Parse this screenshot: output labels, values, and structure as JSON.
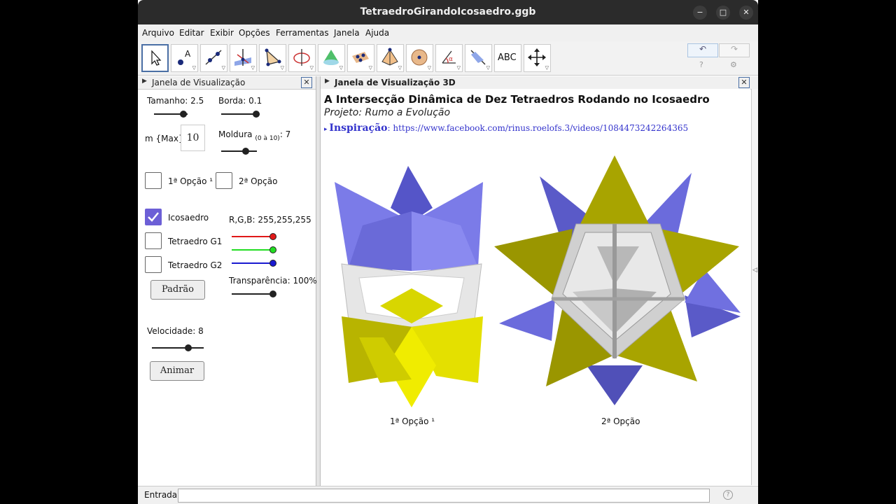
{
  "window": {
    "title": "TetraedroGirandoIcosaedro.ggb",
    "minimize": "−",
    "maximize": "□",
    "close": "✕"
  },
  "menu": [
    "Arquivo",
    "Editar",
    "Exibir",
    "Opções",
    "Ferramentas",
    "Janela",
    "Ajuda"
  ],
  "toolbar": {
    "tools": [
      "move-tool",
      "point-tool",
      "line-tool",
      "perpendicular-tool",
      "polygon-tool",
      "circle-tool",
      "cone-tool",
      "plane-tool",
      "pyramid-tool",
      "sphere-tool",
      "angle-tool",
      "reflect-tool",
      "text-tool",
      "move-view-tool"
    ],
    "text_tool_label": "ABC",
    "undo": "↶",
    "redo": "↷",
    "help": "?",
    "settings": "⚙"
  },
  "left_panel": {
    "header": "Janela de Visualização",
    "tamanho": "Tamanho: 2.5",
    "borda": "Borda: 0.1",
    "m_label": "m {Max}:",
    "m_value": "10",
    "moldura": "Moldura",
    "moldura_range": "(0 à 10)",
    "moldura_value": ": 7",
    "opcao1": "1ª Opção ¹",
    "opcao2": "2ª Opção",
    "icosaedro": "Icosaedro",
    "tetraedro_g1": "Tetraedro G1",
    "tetraedro_g2": "Tetraedro G2",
    "rgb": "R,G,B: 255,255,255",
    "padrao": "Padrão",
    "transparencia": "Transparência: 100%",
    "velocidade": "Velocidade: 8",
    "animar": "Animar"
  },
  "view3d": {
    "header": "Janela de Visualização 3D",
    "title": "A Intersecção Dinâmica de Dez Tetraedros Rodando no Icosaedro",
    "subtitle": "Projeto: Rumo a Evolução",
    "inspiracao": "Inspiração",
    "link": ": https://www.facebook.com/rinus.roelofs.3/videos/1084473242264365",
    "caption1": "1ª Opção ¹",
    "caption2": "2ª Opção"
  },
  "input_bar": {
    "label": "Entrada:",
    "value": "",
    "help": "?"
  },
  "colors": {
    "accent": "#6c5fd6",
    "yellow": "#d8d600",
    "olive": "#9a9600",
    "blue": "#6b6bdc",
    "darkblue": "#5050b8",
    "frame": "#e0e0e0"
  }
}
